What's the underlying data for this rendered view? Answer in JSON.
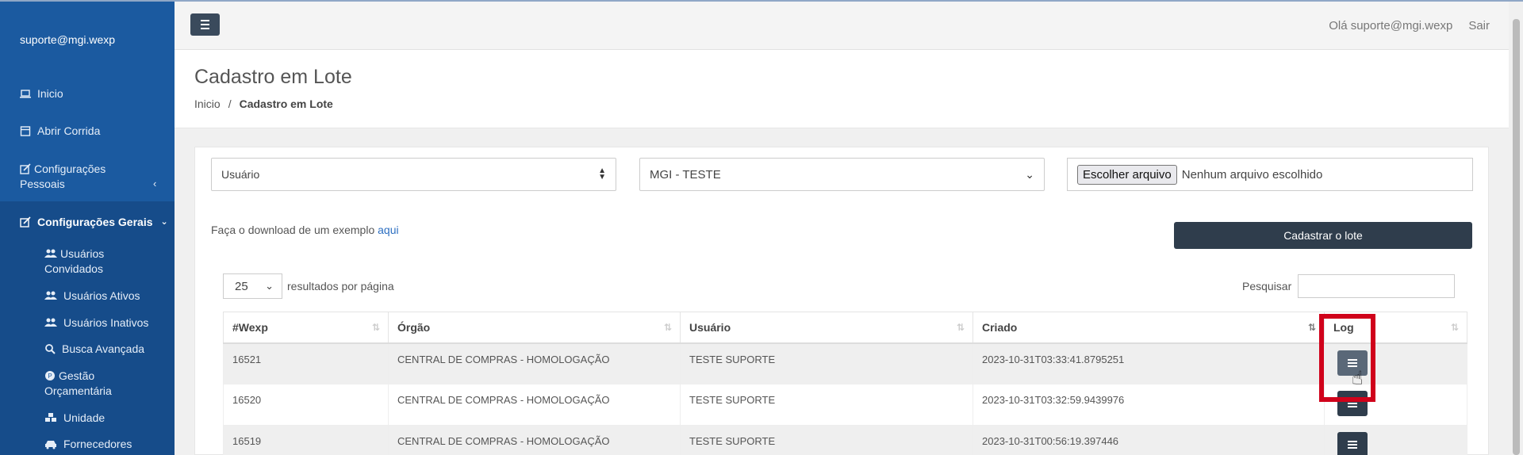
{
  "sidebar": {
    "user": "suporte@mgi.wexp",
    "items": [
      {
        "label": "Inicio"
      },
      {
        "label": "Abrir Corrida"
      },
      {
        "label": "Configurações Pessoais"
      },
      {
        "label": "Configurações Gerais"
      }
    ],
    "subitems": [
      {
        "label": "Usuários Convidados"
      },
      {
        "label": "Usuários Ativos"
      },
      {
        "label": "Usuários Inativos"
      },
      {
        "label": "Busca Avançada"
      },
      {
        "label": "Gestão Orçamentária"
      },
      {
        "label": "Unidade"
      },
      {
        "label": "Fornecedores"
      }
    ]
  },
  "topbar": {
    "greeting": "Olá suporte@mgi.wexp",
    "logout": "Sair"
  },
  "header": {
    "title": "Cadastro em Lote",
    "breadcrumb_home": "Inicio",
    "breadcrumb_sep": "/",
    "breadcrumb_current": "Cadastro em Lote"
  },
  "form": {
    "type_select": "Usuário",
    "org_select": "MGI - TESTE",
    "file_button": "Escolher arquivo",
    "file_status": "Nenhum arquivo escolhido",
    "download_text": "Faça o download de um exemplo",
    "download_link": "aqui",
    "submit": "Cadastrar o lote"
  },
  "table_controls": {
    "page_size": "25",
    "page_size_label": "resultados por página",
    "search_label": "Pesquisar"
  },
  "table": {
    "columns": [
      "#Wexp",
      "Órgão",
      "Usuário",
      "Criado",
      "Log"
    ],
    "rows": [
      {
        "id": "16521",
        "org": "CENTRAL DE COMPRAS - HOMOLOGAÇÃO",
        "user": "TESTE SUPORTE",
        "created": "2023-10-31T03:33:41.8795251"
      },
      {
        "id": "16520",
        "org": "CENTRAL DE COMPRAS - HOMOLOGAÇÃO",
        "user": "TESTE SUPORTE",
        "created": "2023-10-31T03:32:59.9439976"
      },
      {
        "id": "16519",
        "org": "CENTRAL DE COMPRAS - HOMOLOGAÇÃO",
        "user": "TESTE SUPORTE",
        "created": "2023-10-31T00:56:19.397446"
      }
    ]
  },
  "colors": {
    "sidebar": "#1b5aa0",
    "dark_button": "#2f3d4c",
    "highlight": "#d0021b",
    "link": "#2d6fc1"
  }
}
